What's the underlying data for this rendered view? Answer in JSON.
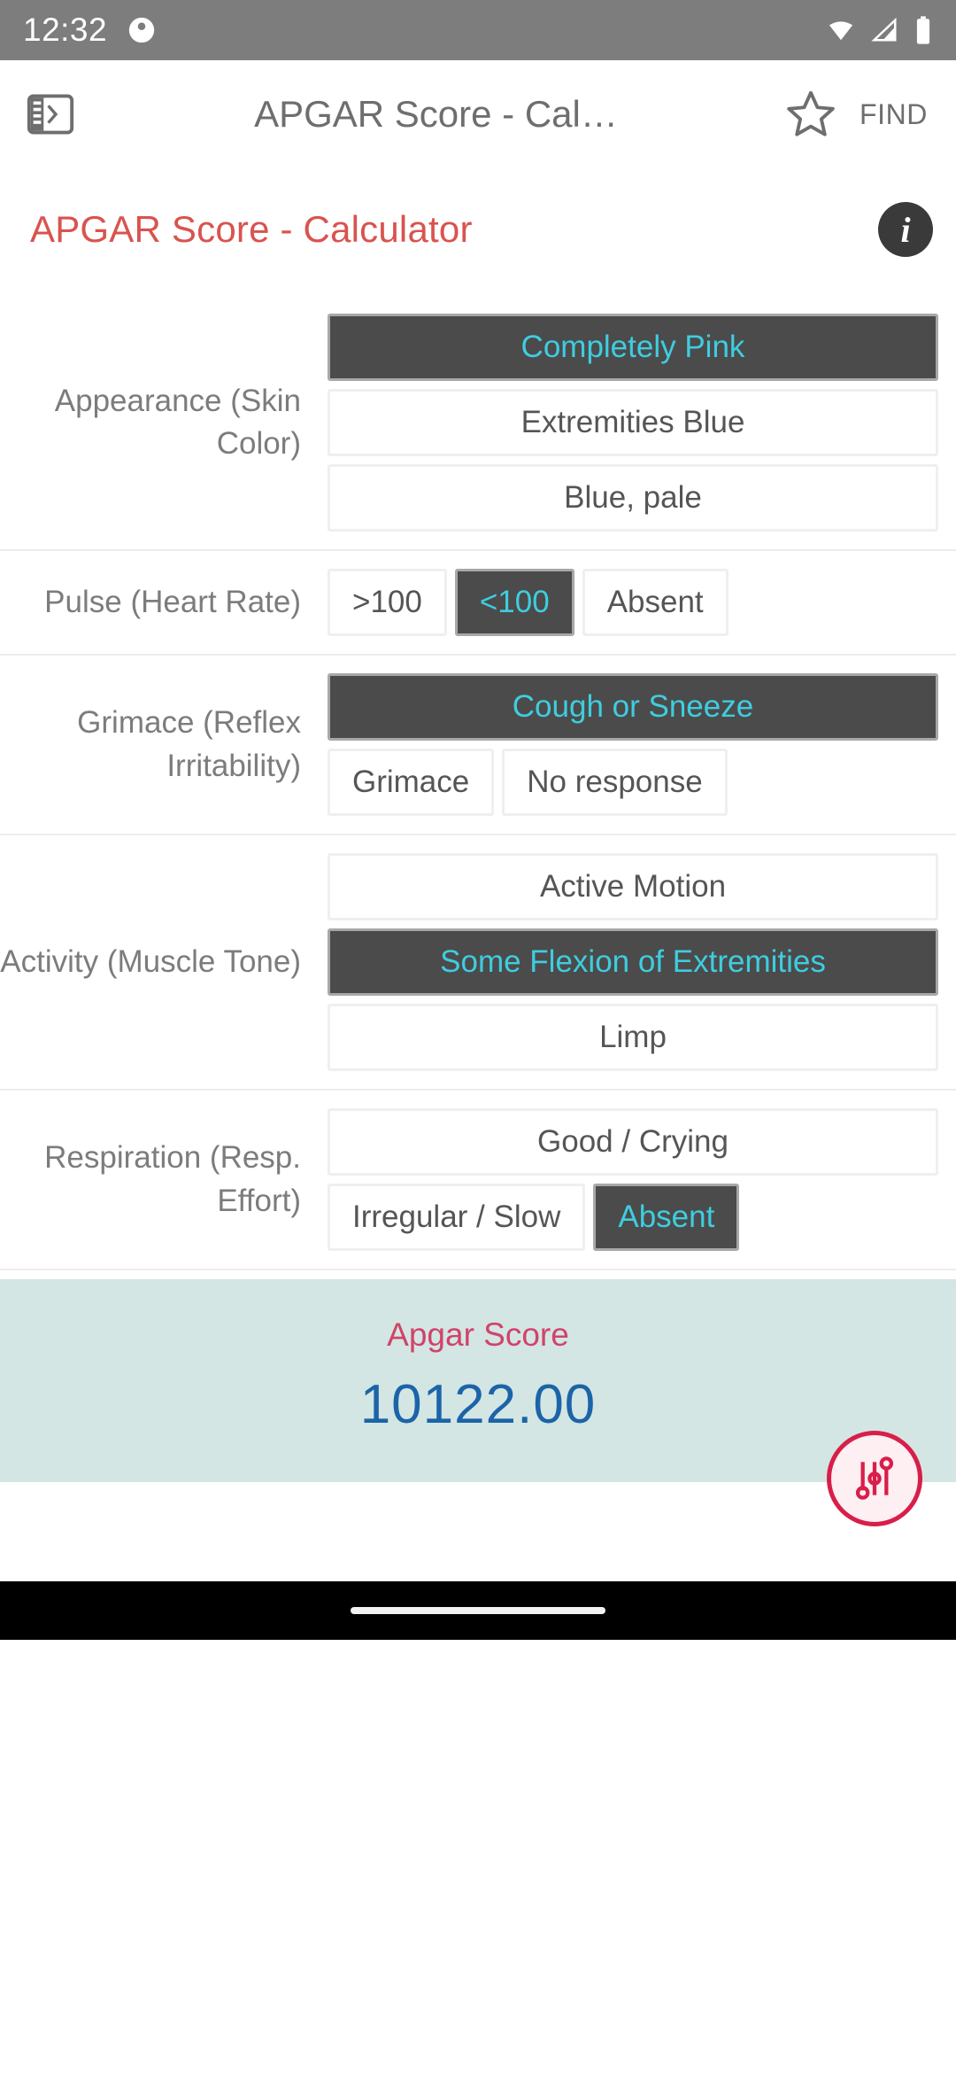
{
  "status_bar": {
    "time": "12:32",
    "left_icon": "alarm-or-app-icon",
    "icons": [
      "wifi-icon",
      "cellular-signal-icon",
      "battery-icon"
    ]
  },
  "app_bar": {
    "drawer_icon": "side-drawer-icon",
    "title": "APGAR Score - Cal…",
    "star_icon": "star-outline-icon",
    "find_label": "FIND"
  },
  "page": {
    "title": "APGAR Score - Calculator",
    "info_icon": "info-icon",
    "title_color": "#d9534f"
  },
  "colors": {
    "selected_bg": "#4b4b4b",
    "selected_text": "#3ecde0",
    "result_bg": "#d3e6e3",
    "result_label": "#d1436b",
    "result_value": "#1c64a8",
    "fab_accent": "#d81e4a"
  },
  "criteria": [
    {
      "label": "Appearance (Skin Color)",
      "options": [
        {
          "text": "Completely Pink",
          "selected": true,
          "full_width": true
        },
        {
          "text": "Extremities Blue",
          "selected": false,
          "full_width": true
        },
        {
          "text": "Blue, pale",
          "selected": false,
          "full_width": true
        }
      ]
    },
    {
      "label": "Pulse (Heart Rate)",
      "options": [
        {
          "text": ">100",
          "selected": false,
          "full_width": false
        },
        {
          "text": "<100",
          "selected": true,
          "full_width": false
        },
        {
          "text": "Absent",
          "selected": false,
          "full_width": false
        }
      ]
    },
    {
      "label": "Grimace (Reflex Irritability)",
      "options": [
        {
          "text": "Cough or Sneeze",
          "selected": true,
          "full_width": true
        },
        {
          "text": "Grimace",
          "selected": false,
          "full_width": false
        },
        {
          "text": "No response",
          "selected": false,
          "full_width": false
        }
      ]
    },
    {
      "label": "Activity (Muscle Tone)",
      "options": [
        {
          "text": "Active Motion",
          "selected": false,
          "full_width": true
        },
        {
          "text": "Some Flexion of Extremities",
          "selected": true,
          "full_width": true
        },
        {
          "text": "Limp",
          "selected": false,
          "full_width": true
        }
      ]
    },
    {
      "label": "Respiration (Resp. Effort)",
      "options": [
        {
          "text": "Good / Crying",
          "selected": false,
          "full_width": true
        },
        {
          "text": "Irregular / Slow",
          "selected": false,
          "full_width": false
        },
        {
          "text": "Absent",
          "selected": true,
          "full_width": false
        }
      ]
    }
  ],
  "result": {
    "label": "Apgar Score",
    "value": "10122.00"
  },
  "fab": {
    "icon": "sliders-settings-icon"
  }
}
